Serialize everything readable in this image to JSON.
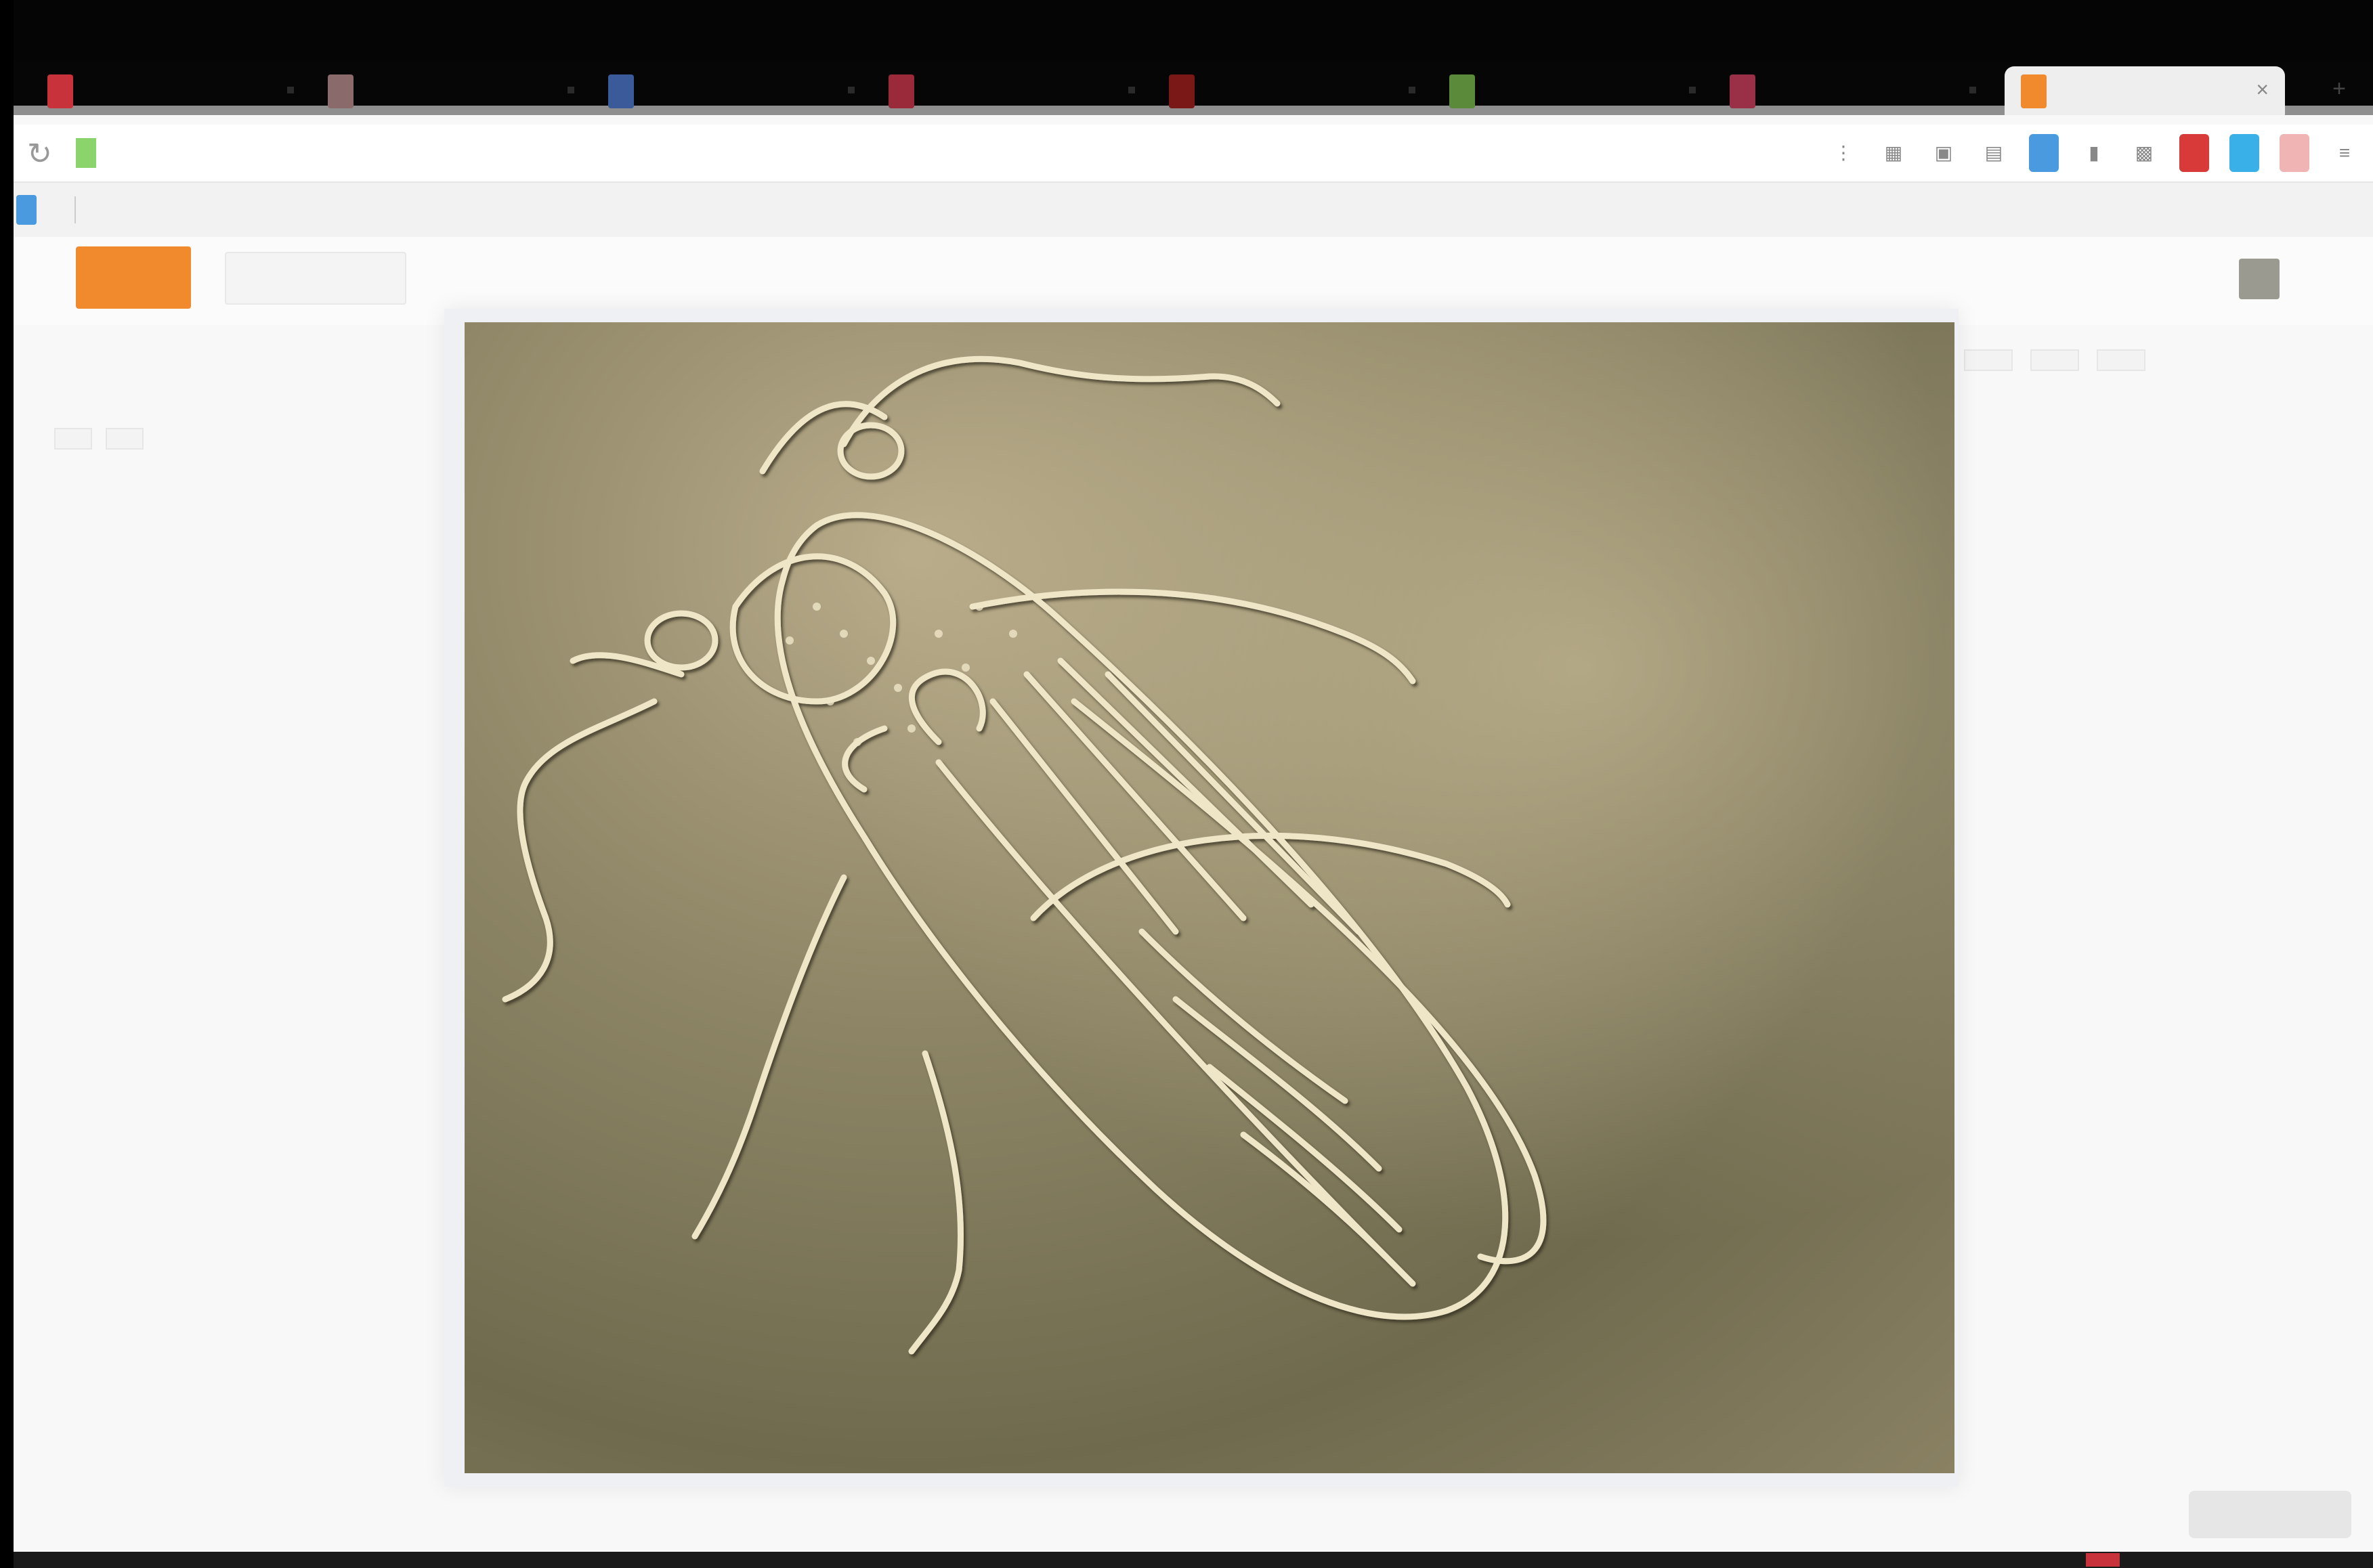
{
  "os_menu": [
    "",
    "",
    "",
    "",
    "",
    ""
  ],
  "tabs": [
    {
      "title": "",
      "favicon_color": "#c8323a"
    },
    {
      "title": "",
      "favicon_color": "#8a6a6a"
    },
    {
      "title": "",
      "favicon_color": "#3b5a9a"
    },
    {
      "title": "",
      "favicon_color": "#9a2a3a"
    },
    {
      "title": "",
      "favicon_color": "#7a1818"
    },
    {
      "title": "",
      "favicon_color": "#5a8a3a"
    },
    {
      "title": "",
      "favicon_color": "#9a3048"
    },
    {
      "title": "",
      "favicon_color": "#f08a2c",
      "active": true
    }
  ],
  "toolbar": {
    "reload_glyph": "↻",
    "address_host": "",
    "address_rest": "",
    "find_text": "",
    "new_tab_glyph": "+",
    "close_tab_glyph": "×"
  },
  "bookmarks": [
    "",
    ""
  ],
  "header": {
    "logo_text": "",
    "nav_button": "",
    "user_name": ""
  },
  "breadcrumb": {
    "text": "",
    "highlight": ""
  },
  "filters": [
    "",
    ""
  ],
  "right_tabs": [
    "",
    "",
    ""
  ],
  "side_link": "",
  "side_list": [
    "",
    "",
    "",
    "",
    ""
  ],
  "lightbox": {
    "caption": "",
    "close_label": "",
    "image_subject": "embossed-metal-insect-relief"
  },
  "colors": {
    "accent": "#f08a2c",
    "link_highlight": "#f6a06a",
    "metal_base": "#8e8666"
  }
}
